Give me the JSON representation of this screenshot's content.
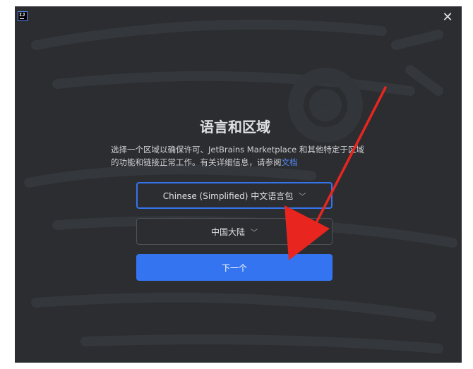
{
  "window": {
    "logo_text": "IJ",
    "close_icon": "close-icon"
  },
  "main": {
    "title": "语言和区域",
    "description_text": "选择一个区域以确保许可、JetBrains Marketplace 和其他特定于区域的功能和链接正常工作。有关详细信息，请参阅",
    "description_link": "文档",
    "language_value": "Chinese (Simplified) 中文语言包",
    "region_value": "中国大陆",
    "next_label": "下一个"
  },
  "colors": {
    "background": "#2b2d30",
    "accent": "#3574f0",
    "link": "#548af7",
    "annotation_arrow": "#e8261f"
  }
}
